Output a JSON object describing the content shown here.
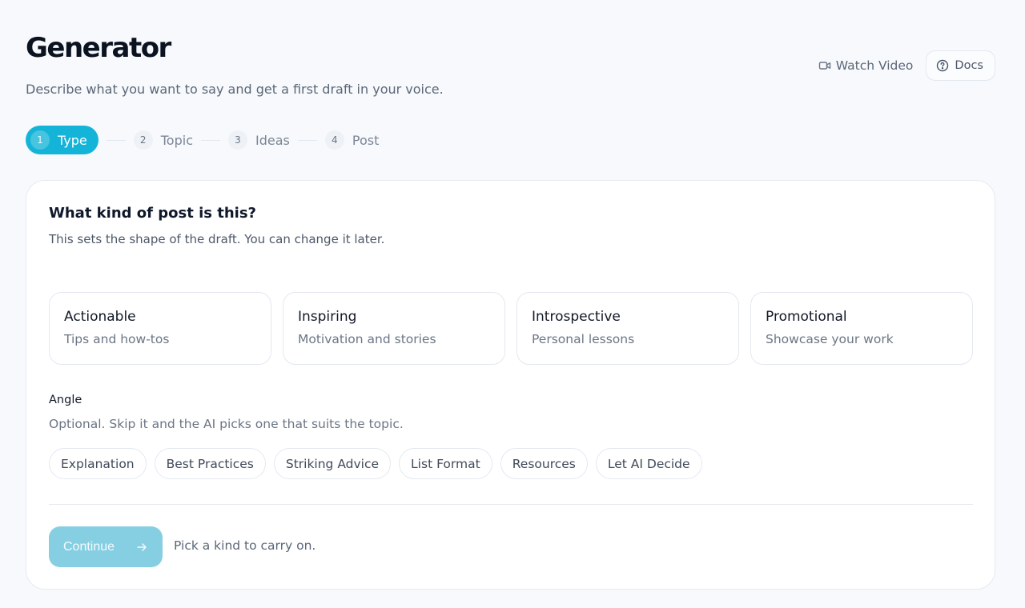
{
  "header": {
    "title": "Generator",
    "subtitle": "Describe what you want to say and get a first draft in your voice.",
    "watch_video_label": "Watch Video",
    "docs_label": "Docs"
  },
  "stepper": {
    "steps": [
      {
        "num": "1",
        "label": "Type",
        "active": true
      },
      {
        "num": "2",
        "label": "Topic",
        "active": false
      },
      {
        "num": "3",
        "label": "Ideas",
        "active": false
      },
      {
        "num": "4",
        "label": "Post",
        "active": false
      }
    ]
  },
  "card": {
    "title": "What kind of post is this?",
    "description": "This sets the shape of the draft. You can change it later.",
    "kinds": [
      {
        "title": "Actionable",
        "subtitle": "Tips and how-tos"
      },
      {
        "title": "Inspiring",
        "subtitle": "Motivation and stories"
      },
      {
        "title": "Introspective",
        "subtitle": "Personal lessons"
      },
      {
        "title": "Promotional",
        "subtitle": "Showcase your work"
      }
    ],
    "angle": {
      "label": "Angle",
      "description": "Optional. Skip it and the AI picks one that suits the topic.",
      "options": [
        "Explanation",
        "Best Practices",
        "Striking Advice",
        "List Format",
        "Resources",
        "Let AI Decide"
      ]
    },
    "continue_label": "Continue",
    "continue_hint": "Pick a kind to carry on."
  },
  "icons": {
    "watch_video": "video-camera-icon",
    "docs": "question-circle-icon",
    "continue": "arrow-right-icon"
  },
  "colors": {
    "accent": "#14b4d8",
    "accent_disabled": "#86cfe2",
    "page_bg": "#f7f9fc"
  }
}
